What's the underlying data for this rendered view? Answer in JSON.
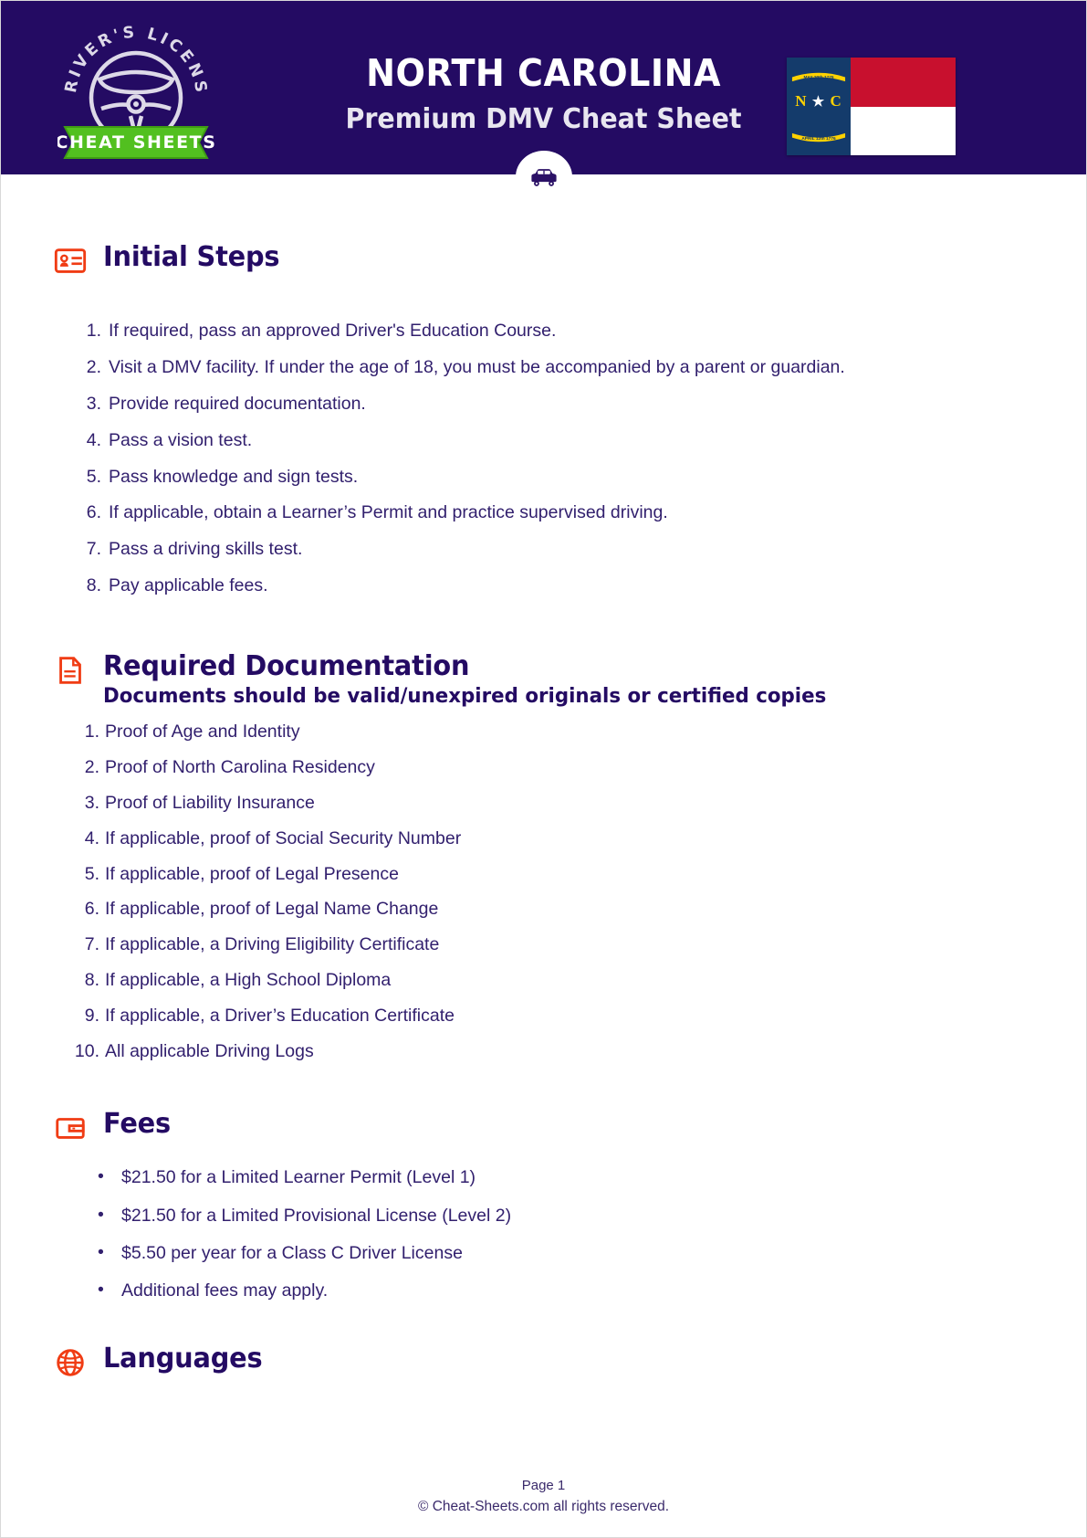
{
  "theme": {
    "header_bg": "#240b63",
    "accent_red": "#f03c14",
    "brand_green": "#52c020",
    "text_purple": "#32206e",
    "flag_blue": "#143b6b",
    "flag_red": "#c8102e",
    "flag_gold": "#ffd200"
  },
  "header": {
    "logo": {
      "arc_text": "DRIVER'S LICENSE",
      "banner_text": "CHEAT SHEETS",
      "icon": "steering-wheel-icon"
    },
    "title": "NORTH CAROLINA",
    "subtitle": "Premium DMV Cheat Sheet",
    "flag": {
      "name": "north-carolina-flag",
      "scroll_top": "MAY 20th 1775",
      "initials_left": "N",
      "initials_right": "C",
      "star": "★",
      "scroll_bottom": "APRIL 12th 1776"
    },
    "badge_icon": "car-icon"
  },
  "sections": [
    {
      "id": "initial-steps",
      "icon": "id-card-icon",
      "title": "Initial Steps",
      "list_type": "ordered",
      "items": [
        "If required, pass an approved Driver's Education Course.",
        "Visit a DMV facility. If under the age of 18, you must be accompanied by a parent or guardian.",
        "Provide required documentation.",
        "Pass a vision test.",
        "Pass knowledge and sign tests.",
        "If applicable, obtain a Learner’s Permit and practice supervised driving.",
        "Pass a driving skills test.",
        "Pay applicable fees."
      ]
    },
    {
      "id": "required-documentation",
      "icon": "document-icon",
      "title": "Required Documentation",
      "subtitle": "Documents should be valid/unexpired originals or certified copies",
      "list_type": "ordered",
      "items": [
        "Proof of Age and Identity",
        "Proof of North Carolina Residency",
        "Proof of Liability Insurance",
        "If applicable, proof of Social Security Number",
        "If applicable, proof of Legal Presence",
        "If applicable, proof of Legal Name Change",
        "If applicable, a Driving Eligibility Certificate",
        "If applicable, a High School Diploma",
        "If applicable, a Driver’s Education Certificate",
        "All applicable Driving Logs"
      ]
    },
    {
      "id": "fees",
      "icon": "wallet-icon",
      "title": "Fees",
      "list_type": "bullet",
      "items": [
        "$21.50 for a Limited Learner Permit (Level 1)",
        "$21.50 for a Limited Provisional License (Level 2)",
        "$5.50 per year for a Class C Driver License",
        "Additional fees may apply."
      ]
    },
    {
      "id": "languages",
      "icon": "globe-icon",
      "title": "Languages",
      "list_type": "none",
      "items": []
    }
  ],
  "footer": {
    "page_label": "Page 1",
    "copyright": "© Cheat-Sheets.com all rights reserved."
  }
}
